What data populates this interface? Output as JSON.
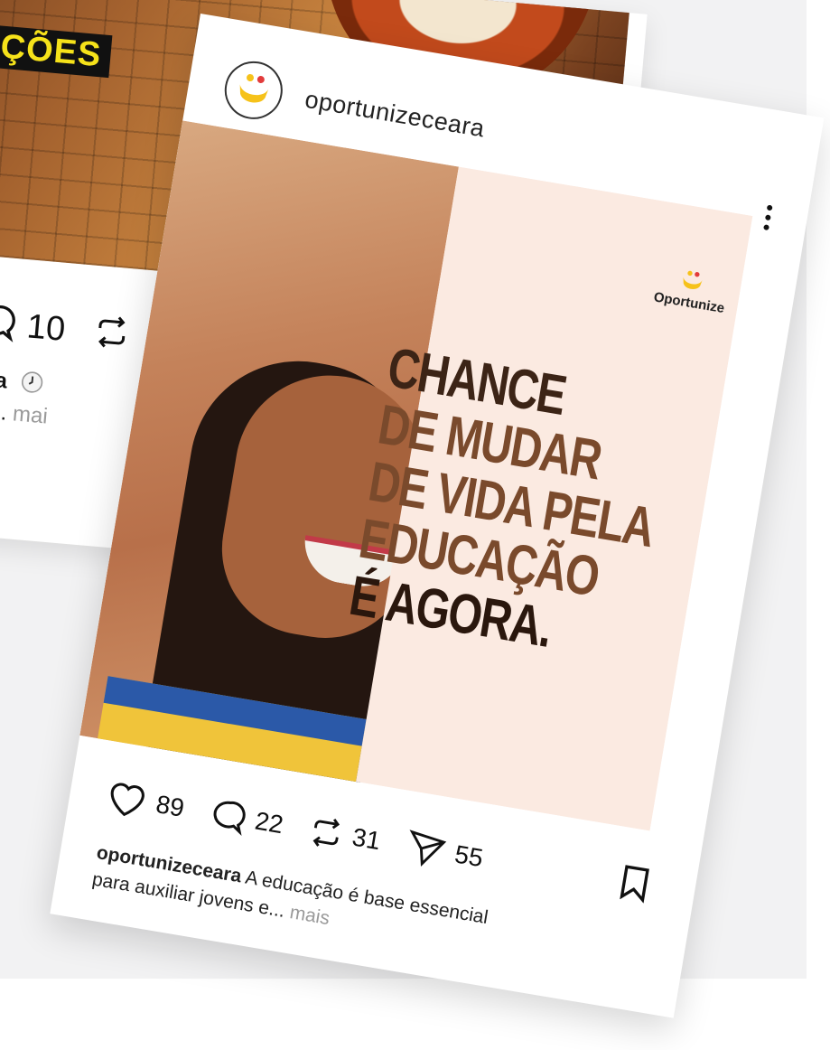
{
  "back_post": {
    "banner_text": "ÇÕES",
    "comment_count": "10",
    "caption_user": "eara",
    "caption_line2": "os!...",
    "more_label": "mai"
  },
  "post": {
    "username": "oportunizeceara",
    "brand_name": "Oportunize",
    "headline": {
      "line1": "CHANCE",
      "line2": "DE MUDAR",
      "line3": "DE VIDA PELA",
      "line4": "EDUCAÇÃO",
      "line5": "É AGORA."
    },
    "likes": "89",
    "comments": "22",
    "reposts": "31",
    "shares": "55",
    "caption_user": "oportunizeceara",
    "caption_text": "A educação é base essencial para auxiliar jovens e...",
    "more_label": "mais"
  },
  "icons": [
    "heart-icon",
    "comment-icon",
    "repost-icon",
    "send-icon",
    "bookmark-icon",
    "more-options-icon",
    "clock-icon"
  ],
  "colors": {
    "accent_yellow": "#f6c21a",
    "accent_red": "#e23b3b",
    "poster_bg": "#fbeae1",
    "page_bg": "#f2f2f3"
  }
}
